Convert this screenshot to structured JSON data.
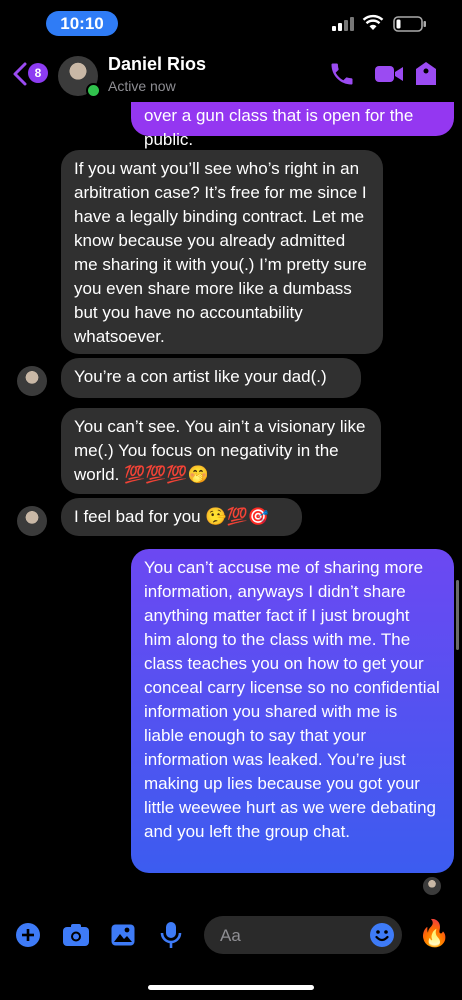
{
  "status_bar": {
    "time": "10:10"
  },
  "header": {
    "back_badge": "8",
    "contact_name": "Daniel Rios",
    "status": "Active now",
    "accent": "#9b4bf2"
  },
  "messages": [
    {
      "side": "out",
      "text": "over a gun class that is open for the\npublic."
    },
    {
      "side": "in",
      "text": "If you want you’ll see who’s right in an arbitration case? It’s free for me since I have a legally binding contract. Let me know because you already admitted me sharing it with you(.) I’m pretty sure you even share more like a dumbass but you have no accountability whatsoever."
    },
    {
      "side": "in",
      "text": "You’re a con artist like your dad(.)"
    },
    {
      "side": "in",
      "text": "You can’t see. You ain’t a visionary like me(.) You focus on negativity in the world. 💯💯💯🤭"
    },
    {
      "side": "in",
      "text": "I feel bad for you 🤥💯🎯"
    },
    {
      "side": "out",
      "text": "You can’t accuse me of sharing more information, anyways I didn’t share anything matter fact if I just brought him along to the class with me. The class teaches you on how to get your conceal carry license so no confidential information you shared with me is liable enough to say that your information was leaked. You’re just making up lies because you got your little weewee hurt as we were debating and you left the group chat."
    }
  ],
  "composer": {
    "placeholder": "Aa",
    "like_emoji": "🔥",
    "icons": [
      "plus-icon",
      "camera-icon",
      "gallery-icon",
      "microphone-icon",
      "emoji-icon",
      "fire-icon"
    ]
  },
  "colors": {
    "accent": "#9b4bf2",
    "outgoing_top": "#9437f1",
    "outgoing_bottom": "#3c5cf0",
    "incoming": "#303030"
  }
}
